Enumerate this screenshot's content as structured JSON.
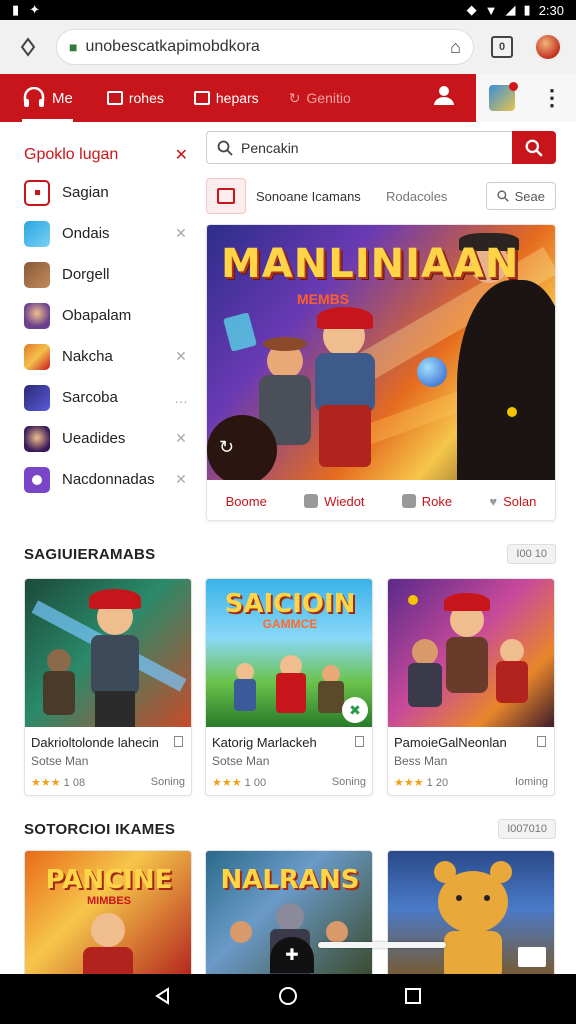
{
  "status": {
    "time": "2:30"
  },
  "browser": {
    "url": "unobescatkapimobdkora",
    "tab_count": "0"
  },
  "nav": {
    "logo_label": "Me",
    "items": [
      {
        "label": "rohes"
      },
      {
        "label": "hepars"
      },
      {
        "label": "Genitio"
      }
    ]
  },
  "sidebar": {
    "title": "Gpoklo lugan",
    "items": [
      {
        "label": "Sagian",
        "color": "#ffffff"
      },
      {
        "label": "Ondais",
        "color": "#2aa4e0"
      },
      {
        "label": "Dorgell",
        "color": "#8a5a3a"
      },
      {
        "label": "Obapalam",
        "color": "#6c3f8f"
      },
      {
        "label": "Nakcha",
        "color": "#e07a2a"
      },
      {
        "label": "Sarcoba",
        "color": "#3a3aa8"
      },
      {
        "label": "Ueadides",
        "color": "#6c2a8f"
      },
      {
        "label": "Nacdonnadas",
        "color": "#7a45c7"
      }
    ]
  },
  "search": {
    "placeholder": "Pencakin"
  },
  "filter": {
    "label": "Sonoane Icamans",
    "label2": "Rodacoles",
    "button": "Seae"
  },
  "hero": {
    "title": "MANLINIAAN",
    "subtitle": "MEMBS",
    "actions": [
      {
        "label": "Boome"
      },
      {
        "label": "Wiedot"
      },
      {
        "label": "Roke"
      },
      {
        "label": "Solan"
      }
    ]
  },
  "section1": {
    "title": "SAGIUIERAMABS",
    "chip": "I00 10",
    "cards": [
      {
        "title": "Dakrioltolonde lahecin",
        "sub": "Sotse Man",
        "rating": "1 08",
        "action": "Soning"
      },
      {
        "title": "Katorig Marlackeh",
        "sub": "Sotse Man",
        "rating": "1 00",
        "action": "Soning",
        "art_title": "SAICIOIN",
        "art_sub": "GAMMCE"
      },
      {
        "title": "PamoieGalNeonlan",
        "sub": "Bess Man",
        "rating": "1 20",
        "action": "Ioming"
      }
    ]
  },
  "section2": {
    "title": "SOTORCIOI IKAMES",
    "chip": "I007010",
    "cards": [
      {
        "art_title": "PANCINE",
        "art_sub": "MIMBES"
      },
      {
        "art_title": "NALRANS"
      },
      {
        "art_title": ""
      }
    ]
  },
  "colors": {
    "brand_red": "#c8151b"
  }
}
